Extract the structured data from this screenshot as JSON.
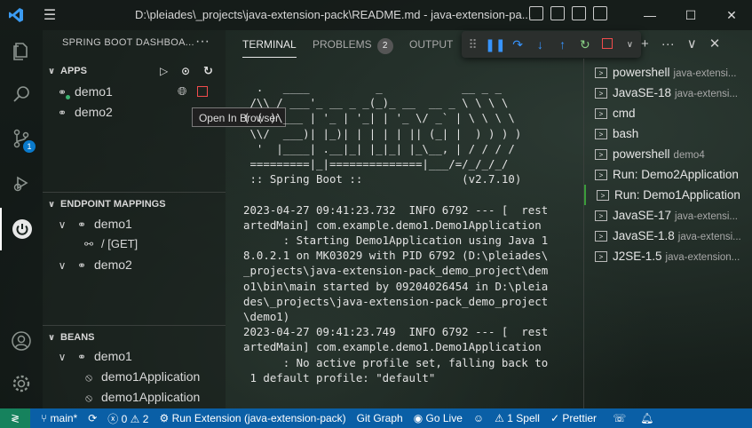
{
  "window": {
    "title": "D:\\pleiades\\_projects\\java-extension-pack\\README.md - java-extension-pa...",
    "controls": [
      "minimize",
      "maximize",
      "close"
    ]
  },
  "activity_bar": {
    "scm_badge": "1"
  },
  "sidebar": {
    "title": "SPRING BOOT DASHBOA...",
    "apps_section": "APPS",
    "apps": [
      {
        "label": "demo1",
        "running": true
      },
      {
        "label": "demo2",
        "running": false
      }
    ],
    "tooltip": "Open In Browser",
    "endpoints_section": "ENDPOINT MAPPINGS",
    "endpoints": [
      {
        "label": "demo1",
        "children": [
          "/ [GET]"
        ]
      },
      {
        "label": "demo2",
        "children": []
      }
    ],
    "beans_section": "BEANS",
    "beans_app": "demo1",
    "beans": [
      "demo1Application",
      "demo1Application"
    ]
  },
  "panel": {
    "tabs": [
      {
        "label": "TERMINAL",
        "active": true
      },
      {
        "label": "PROBLEMS",
        "badge": "2"
      },
      {
        "label": "OUTPUT"
      }
    ],
    "terminal_lines": [
      "  .   ____          _            __ _ _",
      " /\\\\ / ___'_ __ _ _(_)_ __  __ _ \\ \\ \\ \\",
      "( ( )\\___ | '_ | '_| | '_ \\/ _` | \\ \\ \\ \\",
      " \\\\/  ___)| |_)| | | | | || (_| |  ) ) ) )",
      "  '  |____| .__|_| |_|_| |_\\__, | / / / /",
      " =========|_|==============|___/=/_/_/_/",
      " :: Spring Boot ::               (v2.7.10)",
      "",
      "2023-04-27 09:41:23.732  INFO 6792 --- [  rest",
      "artedMain] com.example.demo1.Demo1Application",
      "      : Starting Demo1Application using Java 1",
      "8.0.2.1 on MK03029 with PID 6792 (D:\\pleiades\\",
      "_projects\\java-extension-pack_demo_project\\dem",
      "o1\\bin\\main started by 09204026454 in D:\\pleia",
      "des\\_projects\\java-extension-pack_demo_project",
      "\\demo1)",
      "2023-04-27 09:41:23.749  INFO 6792 --- [  rest",
      "artedMain] com.example.demo1.Demo1Application",
      "      : No active profile set, falling back to",
      " 1 default profile: \"default\""
    ],
    "terminals": [
      {
        "label": "powershell",
        "sub": "java-extensi..."
      },
      {
        "label": "JavaSE-18",
        "sub": "java-extensi..."
      },
      {
        "label": "cmd",
        "sub": ""
      },
      {
        "label": "bash",
        "sub": ""
      },
      {
        "label": "powershell",
        "sub": "demo4"
      },
      {
        "label": "Run: Demo2Application",
        "sub": ""
      },
      {
        "label": "Run: Demo1Application",
        "sub": "",
        "active": true
      },
      {
        "label": "JavaSE-17",
        "sub": "java-extensi..."
      },
      {
        "label": "JavaSE-1.8",
        "sub": "java-extensi..."
      },
      {
        "label": "J2SE-1.5",
        "sub": "java-extension..."
      }
    ]
  },
  "statusbar": {
    "branch": "main*",
    "errors": "0",
    "warnings": "2",
    "run_extension": "Run Extension (java-extension-pack)",
    "git_graph": "Git Graph",
    "go_live": "Go Live",
    "spell": "1 Spell",
    "prettier": "Prettier"
  },
  "colors": {
    "statusbar": "#0a5fa6",
    "remote": "#16825d",
    "running_dot": "#3cb371",
    "debug_blue": "#3794ff",
    "debug_green": "#89d185",
    "debug_red": "#f14c4c"
  }
}
